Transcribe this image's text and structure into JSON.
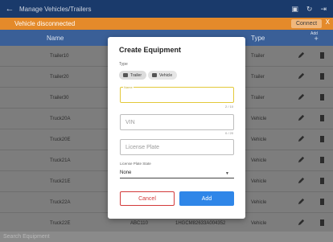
{
  "appbar": {
    "title": "Manage Vehicles/Trailers",
    "back_icon": "arrow-left-icon"
  },
  "banner": {
    "text": "Vehicle disconnected",
    "connect_label": "Connect",
    "close_label": "X"
  },
  "table": {
    "header_name": "Name",
    "header_type": "Type",
    "header_add": "+",
    "header_add_sub": "Add",
    "rows": [
      {
        "name": "Trailer10",
        "col2": "",
        "col3": "",
        "type": "Trailer"
      },
      {
        "name": "Trailer20",
        "col2": "",
        "col3": "",
        "type": "Trailer"
      },
      {
        "name": "Trailer30",
        "col2": "",
        "col3": "",
        "type": "Trailer"
      },
      {
        "name": "Truck20A",
        "col2": "",
        "col3": "",
        "type": "Vehicle"
      },
      {
        "name": "Truck20E",
        "col2": "",
        "col3": "",
        "type": "Vehicle"
      },
      {
        "name": "Truck21A",
        "col2": "",
        "col3": "",
        "type": "Vehicle"
      },
      {
        "name": "Truck21E",
        "col2": "",
        "col3": "",
        "type": "Vehicle"
      },
      {
        "name": "Truck22A",
        "col2": "",
        "col3": "",
        "type": "Vehicle"
      },
      {
        "name": "Truck22E",
        "col2": "ABC110",
        "col3": "1HGCM82633A004352",
        "type": "Vehicle"
      }
    ]
  },
  "search": {
    "placeholder": "Search Equipment"
  },
  "dialog": {
    "title": "Create Equipment",
    "type_label": "Type",
    "chip_trailer": "Trailer",
    "chip_vehicle": "Vehicle",
    "name_label": "Name",
    "name_counter": "2 / 10",
    "vin_placeholder": "VIN",
    "vin_counter": "0 / 20",
    "plate_placeholder": "License Plate",
    "lps_label": "License Plate State",
    "lps_value": "None",
    "cancel_label": "Cancel",
    "add_label": "Add"
  },
  "colors": {
    "appbar": "#1a3a6b",
    "banner": "#e48a2a",
    "header": "#3a5f97",
    "accent_field": "#e3c93a",
    "cancel": "#d33a3a",
    "add": "#2f86e8"
  }
}
